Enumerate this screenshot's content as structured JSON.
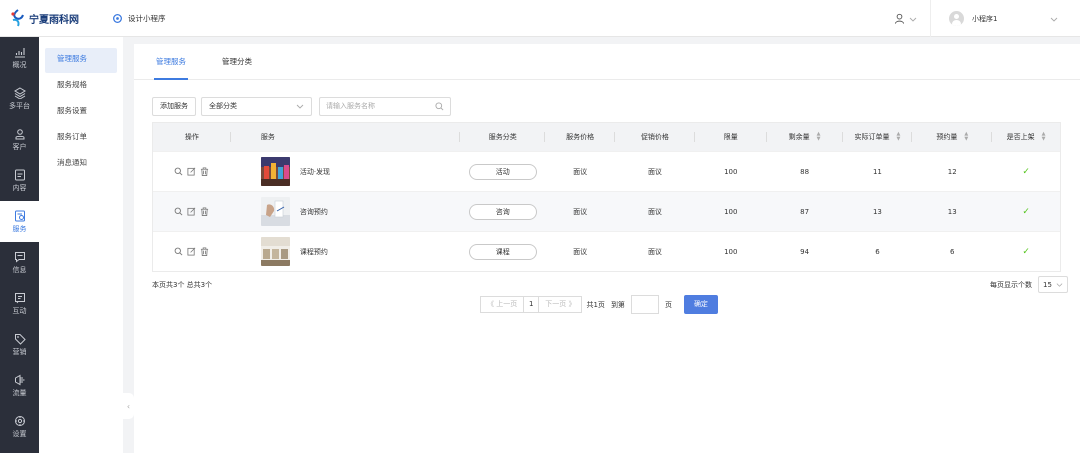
{
  "header": {
    "brand": "宁夏雨科网",
    "app_name": "设计小程序",
    "account_name": "小程序1"
  },
  "sidebar": {
    "items": [
      {
        "label": "概况",
        "icon": "chart-icon",
        "active": false
      },
      {
        "label": "多平台",
        "icon": "layers-icon",
        "active": false
      },
      {
        "label": "客户",
        "icon": "customer-icon",
        "active": false
      },
      {
        "label": "内容",
        "icon": "content-icon",
        "active": false
      },
      {
        "label": "服务",
        "icon": "service-icon",
        "active": true
      },
      {
        "label": "信息",
        "icon": "message-icon",
        "active": false
      },
      {
        "label": "互动",
        "icon": "interact-icon",
        "active": false
      },
      {
        "label": "营销",
        "icon": "tag-icon",
        "active": false
      },
      {
        "label": "流量",
        "icon": "traffic-icon",
        "active": false
      },
      {
        "label": "设置",
        "icon": "settings-icon",
        "active": false
      }
    ]
  },
  "subnav": {
    "items": [
      {
        "label": "管理服务",
        "active": true
      },
      {
        "label": "服务规格",
        "active": false
      },
      {
        "label": "服务设置",
        "active": false
      },
      {
        "label": "服务订单",
        "active": false
      },
      {
        "label": "消息通知",
        "active": false
      }
    ]
  },
  "tabs": [
    {
      "label": "管理服务",
      "active": true
    },
    {
      "label": "管理分类",
      "active": false
    }
  ],
  "toolbar": {
    "add_label": "添加服务",
    "category_value": "全部分类",
    "search_placeholder": "请输入服务名称"
  },
  "table": {
    "headers": {
      "op": "操作",
      "service": "服务",
      "category": "服务分类",
      "price": "服务价格",
      "promo": "促销价格",
      "limit": "限量",
      "remain": "剩余量",
      "orders": "实际订单量",
      "reserve": "预约量",
      "shelf": "是否上架"
    },
    "rows": [
      {
        "name": "活动·发现",
        "category": "活动",
        "price": "面议",
        "promo": "面议",
        "limit": "100",
        "remain": "88",
        "orders": "11",
        "reserve": "12",
        "shelf": "✓"
      },
      {
        "name": "咨询预约",
        "category": "咨询",
        "price": "面议",
        "promo": "面议",
        "limit": "100",
        "remain": "87",
        "orders": "13",
        "reserve": "13",
        "shelf": "✓"
      },
      {
        "name": "课程预约",
        "category": "课程",
        "price": "面议",
        "promo": "面议",
        "limit": "100",
        "remain": "94",
        "orders": "6",
        "reserve": "6",
        "shelf": "✓"
      }
    ]
  },
  "footer": {
    "summary": "本页共3个  总共3个",
    "per_page_label": "每页显示个数",
    "per_page_value": "15",
    "prev": "《 上一页",
    "current_page": "1",
    "next": "下一页 》",
    "total_pages": "共1页",
    "goto_label": "到第",
    "page_unit": "页",
    "confirm": "确定"
  },
  "colors": {
    "accent": "#3d7be0",
    "sidebar_bg": "#2b2f3a",
    "success": "#52c41a"
  }
}
